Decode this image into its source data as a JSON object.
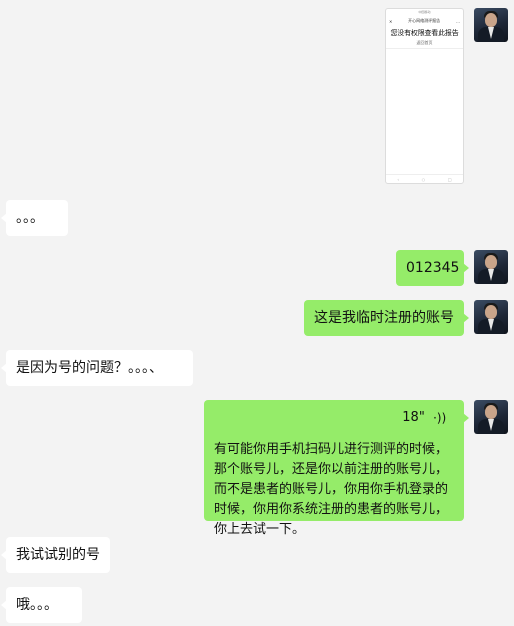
{
  "thumbnail": {
    "status_text": "中国移动",
    "title": "开心网络测评报告",
    "close": "✕",
    "more": "…",
    "message": "您没有权限查看此报告",
    "button": "返回首页",
    "nav_back": "‹",
    "nav_home": "○",
    "nav_recent": "□"
  },
  "messages": [
    {
      "id": "m1",
      "side": "left",
      "text": "。。。"
    },
    {
      "id": "m2",
      "side": "right",
      "text": "012345"
    },
    {
      "id": "m3",
      "side": "right",
      "text": "这是我临时注册的账号"
    },
    {
      "id": "m4",
      "side": "left",
      "text": "是因为号的问题？。。。、"
    },
    {
      "id": "m5",
      "side": "right",
      "voice_duration": "18\"",
      "voice_icon": "((·",
      "transcript": "有可能你用手机扫码儿进行测评的时候，那个账号儿，还是你以前注册的账号儿，而不是患者的账号儿，你用你手机登录的时候，你用你系统注册的患者的账号儿，你上去试一下。"
    },
    {
      "id": "m6",
      "side": "left",
      "text": "我试试别的号"
    },
    {
      "id": "m7",
      "side": "left",
      "text": "哦。。。"
    }
  ],
  "colors": {
    "sent_bubble": "#95ec69",
    "received_bubble": "#ffffff",
    "background": "#f3f3f3"
  }
}
